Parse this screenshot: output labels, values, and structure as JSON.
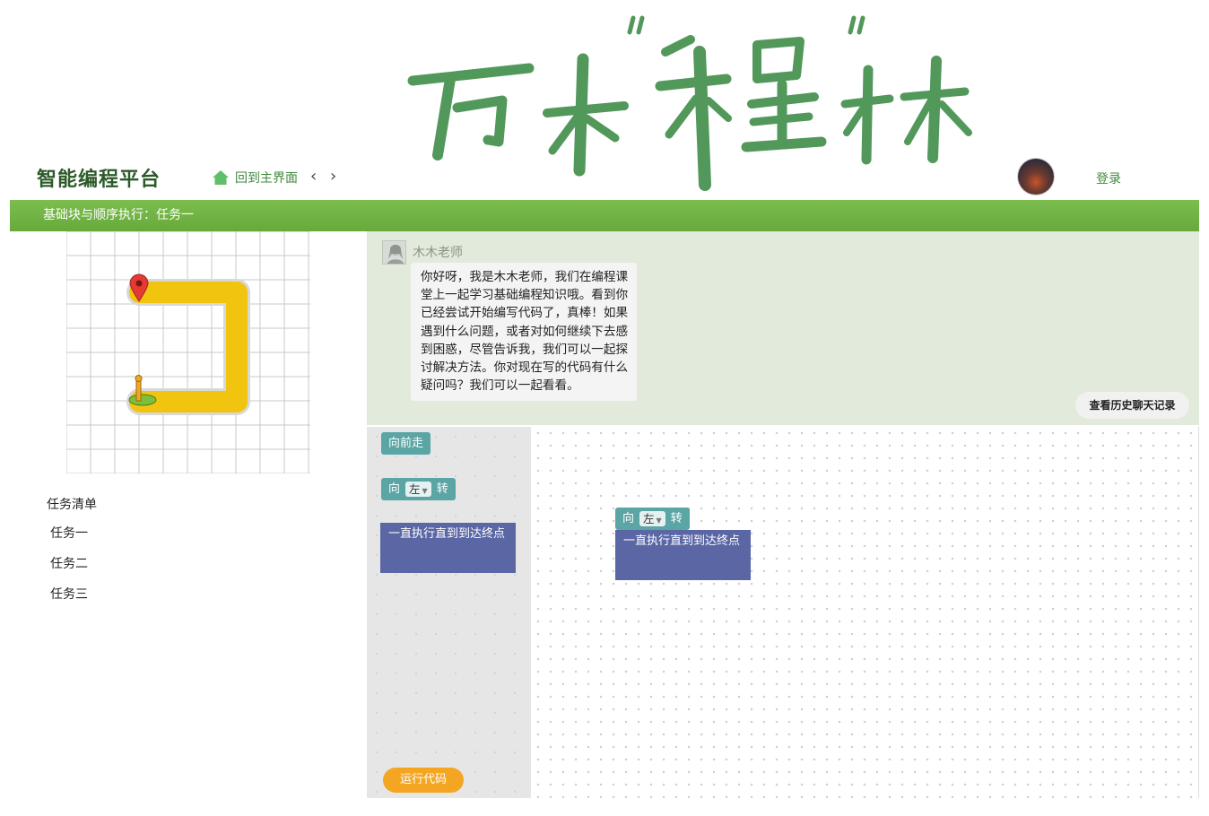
{
  "header": {
    "logo_text": "万木\"程\"林",
    "brand": "智能编程平台",
    "home_label": "回到主界面",
    "back_icon": "chevron-left-icon",
    "forward_icon": "chevron-right-icon",
    "login_label": "登录"
  },
  "task_bar": {
    "title": "基础块与顺序执行：任务一"
  },
  "tasks": {
    "heading": "任务清单",
    "items": [
      "任务一",
      "任务二",
      "任务三"
    ]
  },
  "chat": {
    "teacher_name": "木木老师",
    "message": "你好呀，我是木木老师，我们在编程课堂上一起学习基础编程知识哦。看到你已经尝试开始编写代码了，真棒！如果遇到什么问题，或者对如何继续下去感到困惑，尽管告诉我，我们可以一起探讨解决方法。你对现在写的代码有什么疑问吗？我们可以一起看看。",
    "history_button": "查看历史聊天记录"
  },
  "toolbox": {
    "forward_block": "向前走",
    "turn_block": {
      "prefix": "向",
      "direction": "左",
      "suffix": "转"
    },
    "loop_block": "一直执行直到到达终点"
  },
  "workspace": {
    "turn_block": {
      "prefix": "向",
      "direction": "左",
      "suffix": "转"
    },
    "loop_block": "一直执行直到到达终点"
  },
  "run_button": "运行代码",
  "colors": {
    "brand_green": "#2c5a2a",
    "bar_green": "#6fb043",
    "path_yellow": "#f1c40f",
    "teal_block": "#5ba5a5",
    "loop_block": "#5b67a5",
    "run_orange": "#f4a623"
  }
}
